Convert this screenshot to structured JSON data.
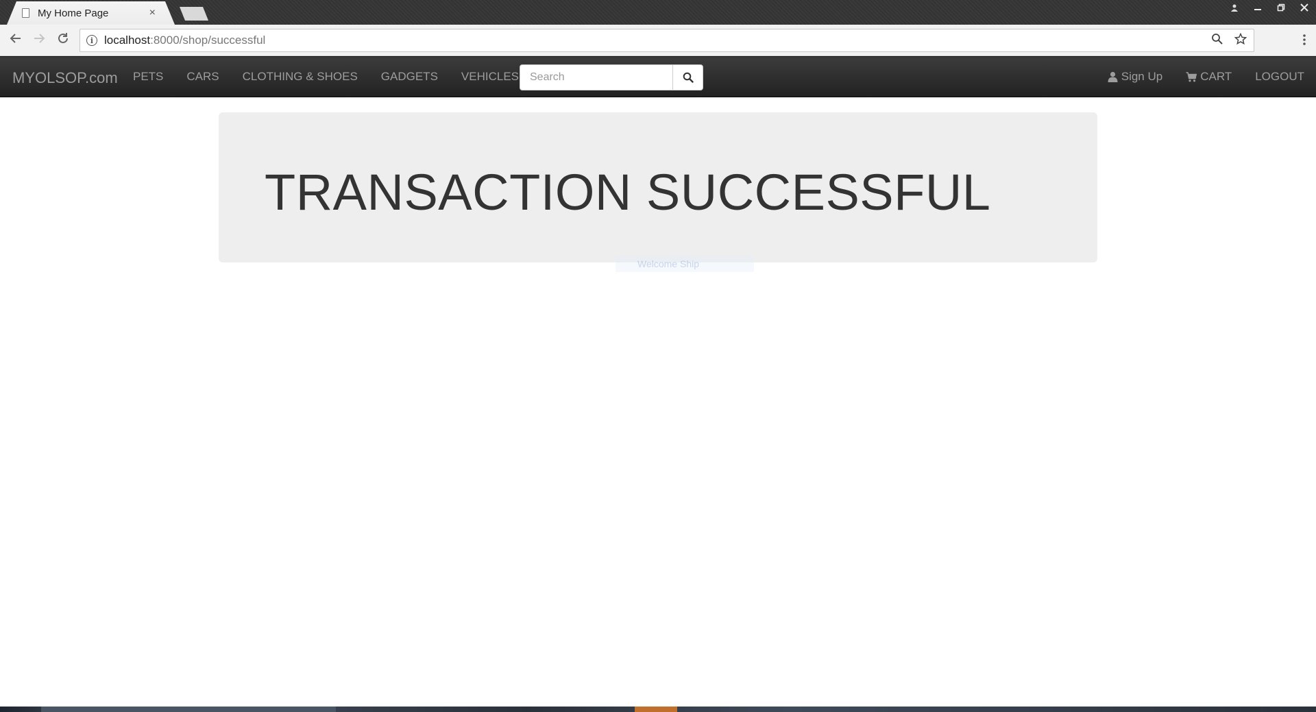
{
  "browser": {
    "tab_title": "My Home Page",
    "tab_close": "×",
    "url_host": "localhost",
    "url_rest": ":8000/shop/successful",
    "window_controls": [
      "user",
      "minimize",
      "restore",
      "close"
    ]
  },
  "site": {
    "brand": "MYOLSOP.com",
    "nav_links": [
      "PETS",
      "CARS",
      "CLOTHING & SHOES",
      "GADGETS",
      "VEHICLES"
    ],
    "search_placeholder": "Search",
    "sign_up": "Sign Up",
    "cart": "CART",
    "logout": "LOGOUT"
  },
  "main": {
    "heading": "TRANSACTION SUCCESSFUL",
    "tooltip": "Welcome Ship"
  },
  "colors": {
    "navbar": "#222222",
    "nav_text": "#9d9d9d",
    "jumbotron_bg": "#eeeeee",
    "heading_text": "#333333"
  }
}
